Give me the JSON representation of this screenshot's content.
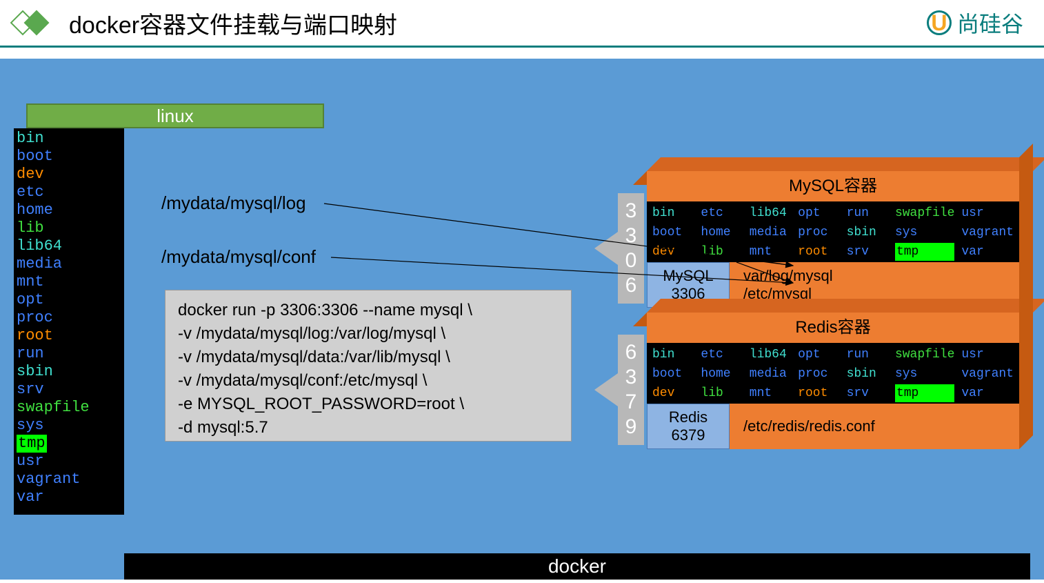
{
  "header": {
    "title": "docker容器文件挂载与端口映射",
    "brand": "尚硅谷",
    "brand_icon": "U"
  },
  "linux": {
    "label": "linux",
    "dirs": [
      {
        "name": "bin",
        "cls": "c-cyan"
      },
      {
        "name": "boot",
        "cls": "c-blue"
      },
      {
        "name": "dev",
        "cls": "c-orange"
      },
      {
        "name": "etc",
        "cls": "c-blue"
      },
      {
        "name": "home",
        "cls": "c-blue"
      },
      {
        "name": "lib",
        "cls": "c-green"
      },
      {
        "name": "lib64",
        "cls": "c-cyan"
      },
      {
        "name": "media",
        "cls": "c-blue"
      },
      {
        "name": "mnt",
        "cls": "c-blue"
      },
      {
        "name": "opt",
        "cls": "c-blue"
      },
      {
        "name": "proc",
        "cls": "c-blue"
      },
      {
        "name": "root",
        "cls": "c-orange"
      },
      {
        "name": "run",
        "cls": "c-blue"
      },
      {
        "name": "sbin",
        "cls": "c-cyan"
      },
      {
        "name": "srv",
        "cls": "c-blue"
      },
      {
        "name": "swapfile",
        "cls": "c-green"
      },
      {
        "name": "sys",
        "cls": "c-blue"
      },
      {
        "name": "tmp",
        "cls": "c-hl"
      },
      {
        "name": "usr",
        "cls": "c-blue"
      },
      {
        "name": "vagrant",
        "cls": "c-blue"
      },
      {
        "name": "var",
        "cls": "c-blue"
      }
    ]
  },
  "hostPaths": {
    "log": "/mydata/mysql/log",
    "conf": "/mydata/mysql/conf"
  },
  "command": {
    "l1": "docker run -p 3306:3306 --name mysql \\",
    "l2": "-v /mydata/mysql/log:/var/log/mysql \\",
    "l3": "-v /mydata/mysql/data:/var/lib/mysql \\",
    "l4": "-v /mydata/mysql/conf:/etc/mysql \\",
    "l5": "-e MYSQL_ROOT_PASSWORD=root \\",
    "l6": "-d mysql:5.7"
  },
  "dockerLabel": "docker",
  "mysql": {
    "title": "MySQL容器",
    "name": "MySQL",
    "innerPort": "3306",
    "hostPort": "3306",
    "path1": "var/log/mysql",
    "path2": "/etc/mysql"
  },
  "redis": {
    "title": "Redis容器",
    "name": "Redis",
    "innerPort": "6379",
    "hostPort": "6379",
    "path1": "/etc/redis/redis.conf"
  },
  "containerFs": [
    {
      "name": "bin",
      "cls": "c-cyan"
    },
    {
      "name": "etc",
      "cls": "c-blue"
    },
    {
      "name": "lib64",
      "cls": "c-cyan"
    },
    {
      "name": "opt",
      "cls": "c-blue"
    },
    {
      "name": "run",
      "cls": "c-blue"
    },
    {
      "name": "swapfile",
      "cls": "c-green"
    },
    {
      "name": "usr",
      "cls": "c-blue"
    },
    {
      "name": "boot",
      "cls": "c-blue"
    },
    {
      "name": "home",
      "cls": "c-blue"
    },
    {
      "name": "media",
      "cls": "c-blue"
    },
    {
      "name": "proc",
      "cls": "c-blue"
    },
    {
      "name": "sbin",
      "cls": "c-cyan"
    },
    {
      "name": "sys",
      "cls": "c-blue"
    },
    {
      "name": "vagrant",
      "cls": "c-blue"
    },
    {
      "name": "dev",
      "cls": "c-orange"
    },
    {
      "name": "lib",
      "cls": "c-green"
    },
    {
      "name": "mnt",
      "cls": "c-blue"
    },
    {
      "name": "root",
      "cls": "c-orange"
    },
    {
      "name": "srv",
      "cls": "c-blue"
    },
    {
      "name": "tmp",
      "cls": "c-hl"
    },
    {
      "name": "var",
      "cls": "c-blue"
    }
  ]
}
